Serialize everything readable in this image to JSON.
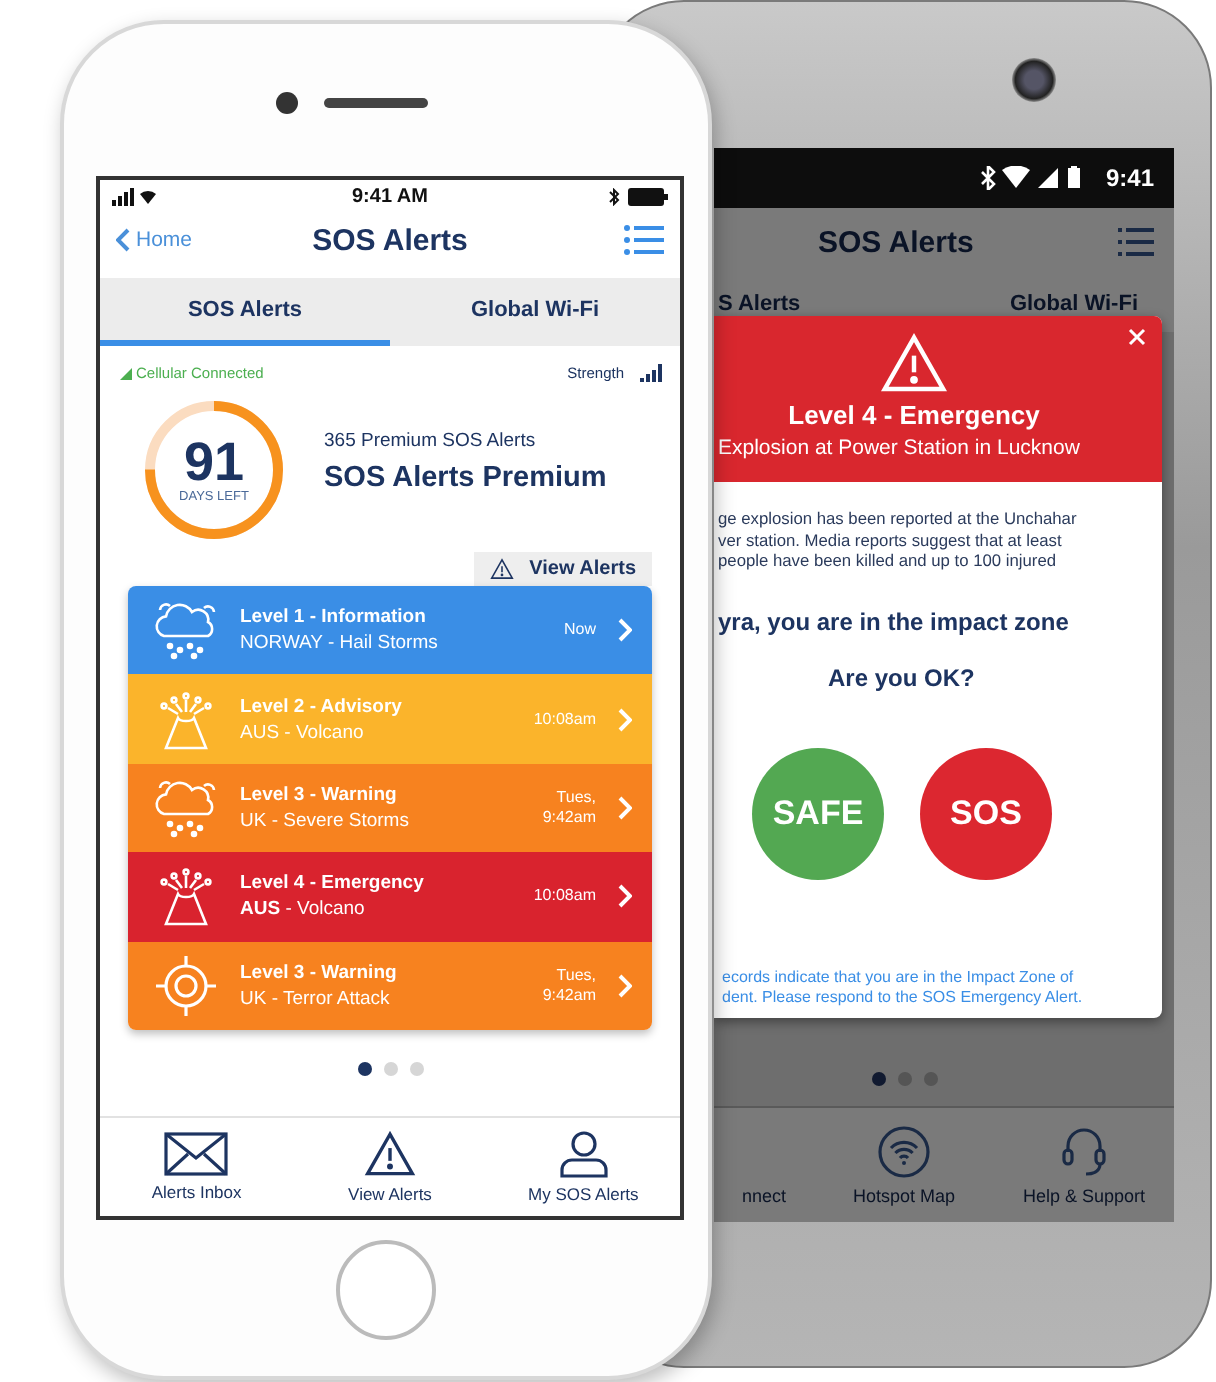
{
  "front_phone": {
    "status_bar": {
      "time": "9:41 AM"
    },
    "nav": {
      "back_label": "Home",
      "title": "SOS Alerts"
    },
    "tabs": [
      {
        "label": "SOS Alerts",
        "selected": true
      },
      {
        "label": "Global Wi-Fi",
        "selected": false
      }
    ],
    "connection": {
      "status": "Cellular Connected",
      "strength_label": "Strength"
    },
    "plan": {
      "days": "91",
      "days_caption": "DAYS LEFT",
      "level": 0.75,
      "subtitle": "365 Premium SOS Alerts",
      "title": "SOS Alerts Premium"
    },
    "view_alerts_button": "View Alerts",
    "alerts": [
      {
        "kind": "storm",
        "title": "Level 1 - Information",
        "region": "NORWAY - Hail Storms",
        "time": "Now",
        "color": "#3a8ee6"
      },
      {
        "kind": "volcano",
        "title": "Level 2 - Advisory",
        "region": "AUS - Volcano",
        "time": "10:08am",
        "color": "#fbb42b"
      },
      {
        "kind": "storm",
        "title": "Level 3 - Warning",
        "region": "UK -  Severe Storms",
        "time": "Tues, 9:42am",
        "color": "#f7821f"
      },
      {
        "kind": "volcano",
        "title": "Level 4 - Emergency",
        "region": "**AUS** - Volcano",
        "time": "10:08am",
        "color": "#d9232e"
      },
      {
        "kind": "target",
        "title": "Level 3 - Warning",
        "region": "UK - Terror Attack",
        "time": "Tues, 9:42am",
        "color": "#f7821f"
      }
    ],
    "pager": [
      {
        "selected": true
      },
      {
        "selected": false
      },
      {
        "selected": false
      }
    ],
    "bottom_nav": [
      {
        "kind": "inbox",
        "label": "Alerts Inbox"
      },
      {
        "kind": "warning",
        "label": "View Alerts"
      },
      {
        "kind": "person",
        "label": "My SOS Alerts"
      }
    ]
  },
  "back_phone": {
    "status_bar": {
      "time": "9:41"
    },
    "title": "SOS Alerts",
    "tabs": [
      {
        "label": "S Alerts"
      },
      {
        "label": "Global Wi-Fi"
      }
    ],
    "popup": {
      "level_title": "Level 4 - Emergency",
      "subtitle": "Explosion at Power Station in Lucknow",
      "body_lines": [
        "ge explosion has been reported at the Unchahar",
        "ver station. Media reports suggest that at least",
        "people have been killed and up to 100 injured"
      ],
      "message": "yra, you are in the impact zone",
      "question": "Are you OK?",
      "actions": [
        {
          "kind": "safe",
          "label": "SAFE"
        },
        {
          "kind": "sos",
          "label": "SOS"
        }
      ],
      "footnote_lines": [
        "ecords indicate that you are in the Impact Zone of",
        "dent. Please respond to the SOS Emergency Alert."
      ]
    },
    "pager": [
      {
        "selected": true
      },
      {
        "selected": false
      },
      {
        "selected": false
      }
    ],
    "bottom_nav": [
      {
        "kind": "connect",
        "label": "nnect"
      },
      {
        "kind": "hotspot",
        "label": "Hotspot Map"
      },
      {
        "kind": "support",
        "label": "Help & Support"
      }
    ]
  }
}
